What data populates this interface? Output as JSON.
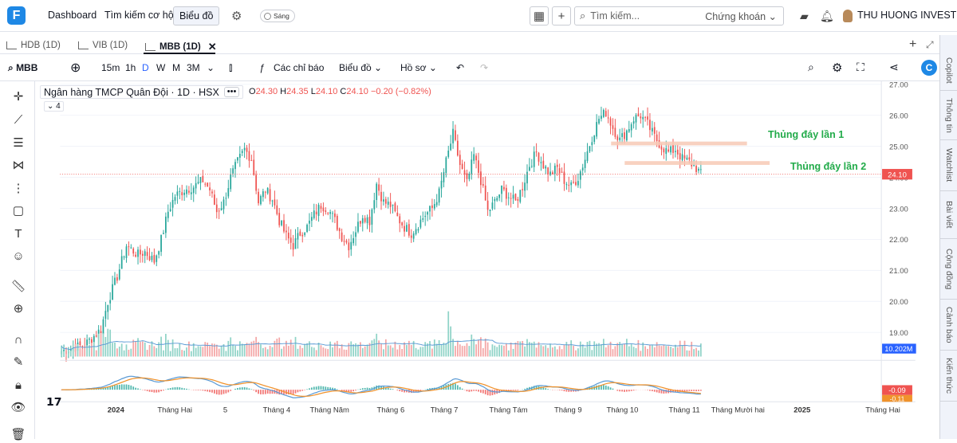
{
  "topbar": {
    "logo": "F",
    "nav_dashboard": "Dashboard",
    "nav_opportunities": "Tìm kiếm cơ hội",
    "nav_chart": "Biểu đồ",
    "theme_label": "Sáng",
    "search_placeholder": "Tìm kiếm...",
    "search_scope": "Chứng khoán",
    "user_name": "THU HUONG INVEST"
  },
  "tabs": [
    {
      "label": "HDB (1D)"
    },
    {
      "label": "VIB (1D)"
    },
    {
      "label": "MBB (1D)"
    }
  ],
  "toolbar": {
    "symbol": "MBB",
    "tf_15m": "15m",
    "tf_1h": "1h",
    "tf_d": "D",
    "tf_w": "W",
    "tf_m": "M",
    "tf_3m": "3M",
    "indicators": "Các chỉ báo",
    "chart_type": "Biểu đồ",
    "profile": "Hồ sơ"
  },
  "legend": {
    "title": "Ngân hàng TMCP Quân Đội · 1D · HSX",
    "o_label": "O",
    "o": "24.30",
    "h_label": "H",
    "h": "24.35",
    "l_label": "L",
    "l": "24.10",
    "c_label": "C",
    "c": "24.10",
    "change": "−0.20 (−0.82%)",
    "collapse": "4"
  },
  "annotations": {
    "first": "Thủng đáy lần 1",
    "second": "Thủng đáy lần 2"
  },
  "right_tabs": [
    "Copilot",
    "Thông tin",
    "Watchlist",
    "Bài viết",
    "Cộng đồng",
    "Cảnh báo",
    "Kiến thức"
  ],
  "colors": {
    "up": "#26a69a",
    "down": "#ef5350",
    "accent": "#2962ff",
    "zone": "#f7c9b5",
    "label_green": "#22ab4a",
    "vol_ma": "#5b9bd5"
  },
  "chart_data": {
    "type": "candlestick",
    "symbol": "MBB",
    "exchange": "HSX",
    "interval": "1D",
    "price_axis": {
      "ticks": [
        "27.00",
        "26.00",
        "25.00",
        "24.00",
        "23.00",
        "22.00",
        "21.00",
        "20.00",
        "19.00"
      ],
      "ylim": [
        18.3,
        27.0
      ]
    },
    "last_price": "24.10",
    "volume_ma_label": "10.202M",
    "osc_labels": [
      "-0.09",
      "-0.11"
    ],
    "time_axis": [
      "2024",
      "Tháng Hai",
      "5",
      "Tháng 4",
      "Tháng Năm",
      "Tháng 6",
      "Tháng 7",
      "Tháng Tám",
      "Tháng 9",
      "Tháng 10",
      "Tháng 11",
      "Tháng Mười hai",
      "2025",
      "Tháng Hai"
    ],
    "waypoints": [
      [
        0,
        18.4
      ],
      [
        10,
        18.6
      ],
      [
        17,
        19.1
      ],
      [
        20,
        20.0
      ],
      [
        24,
        20.8
      ],
      [
        28,
        21.8
      ],
      [
        33,
        21.5
      ],
      [
        36,
        21.6
      ],
      [
        40,
        21.3
      ],
      [
        43,
        22.0
      ],
      [
        46,
        22.9
      ],
      [
        49,
        23.4
      ],
      [
        53,
        23.6
      ],
      [
        57,
        23.7
      ],
      [
        61,
        23.9
      ],
      [
        64,
        23.6
      ],
      [
        67,
        22.9
      ],
      [
        70,
        23.2
      ],
      [
        73,
        24.0
      ],
      [
        76,
        24.5
      ],
      [
        79,
        24.9
      ],
      [
        82,
        24.6
      ],
      [
        85,
        23.2
      ],
      [
        88,
        23.6
      ],
      [
        91,
        23.3
      ],
      [
        94,
        22.6
      ],
      [
        97,
        22.1
      ],
      [
        100,
        21.8
      ],
      [
        103,
        22.2
      ],
      [
        106,
        22.4
      ],
      [
        109,
        22.8
      ],
      [
        112,
        23.1
      ],
      [
        115,
        23.0
      ],
      [
        118,
        22.6
      ],
      [
        121,
        22.1
      ],
      [
        124,
        21.8
      ],
      [
        127,
        22.3
      ],
      [
        130,
        22.8
      ],
      [
        133,
        22.6
      ],
      [
        136,
        23.8
      ],
      [
        139,
        23.2
      ],
      [
        142,
        23.1
      ],
      [
        145,
        22.7
      ],
      [
        148,
        22.4
      ],
      [
        151,
        22.2
      ],
      [
        154,
        22.5
      ],
      [
        157,
        22.8
      ],
      [
        160,
        23.0
      ],
      [
        163,
        23.5
      ],
      [
        166,
        24.5
      ],
      [
        169,
        25.4
      ],
      [
        172,
        24.4
      ],
      [
        175,
        23.8
      ],
      [
        178,
        24.7
      ],
      [
        181,
        23.9
      ],
      [
        184,
        22.9
      ],
      [
        187,
        23.2
      ],
      [
        190,
        23.6
      ],
      [
        193,
        23.4
      ],
      [
        196,
        23.2
      ],
      [
        199,
        23.7
      ],
      [
        202,
        24.4
      ],
      [
        205,
        24.8
      ],
      [
        208,
        24.4
      ],
      [
        211,
        24.1
      ],
      [
        214,
        24.3
      ],
      [
        217,
        23.9
      ],
      [
        220,
        23.7
      ],
      [
        223,
        24.0
      ],
      [
        226,
        24.6
      ],
      [
        229,
        25.3
      ],
      [
        232,
        25.9
      ],
      [
        235,
        26.1
      ],
      [
        238,
        25.6
      ],
      [
        241,
        25.2
      ],
      [
        244,
        25.5
      ],
      [
        247,
        25.9
      ],
      [
        250,
        26.0
      ],
      [
        253,
        25.7
      ],
      [
        256,
        25.3
      ],
      [
        259,
        25.0
      ],
      [
        262,
        24.8
      ],
      [
        265,
        24.9
      ],
      [
        268,
        24.6
      ],
      [
        271,
        24.5
      ],
      [
        274,
        24.3
      ],
      [
        276,
        24.1
      ]
    ],
    "markup": [
      {
        "type": "zone",
        "label": "Thủng đáy lần 1",
        "price": 25.08
      },
      {
        "type": "zone",
        "label": "Thủng đáy lần 2",
        "price": 24.45
      }
    ]
  }
}
